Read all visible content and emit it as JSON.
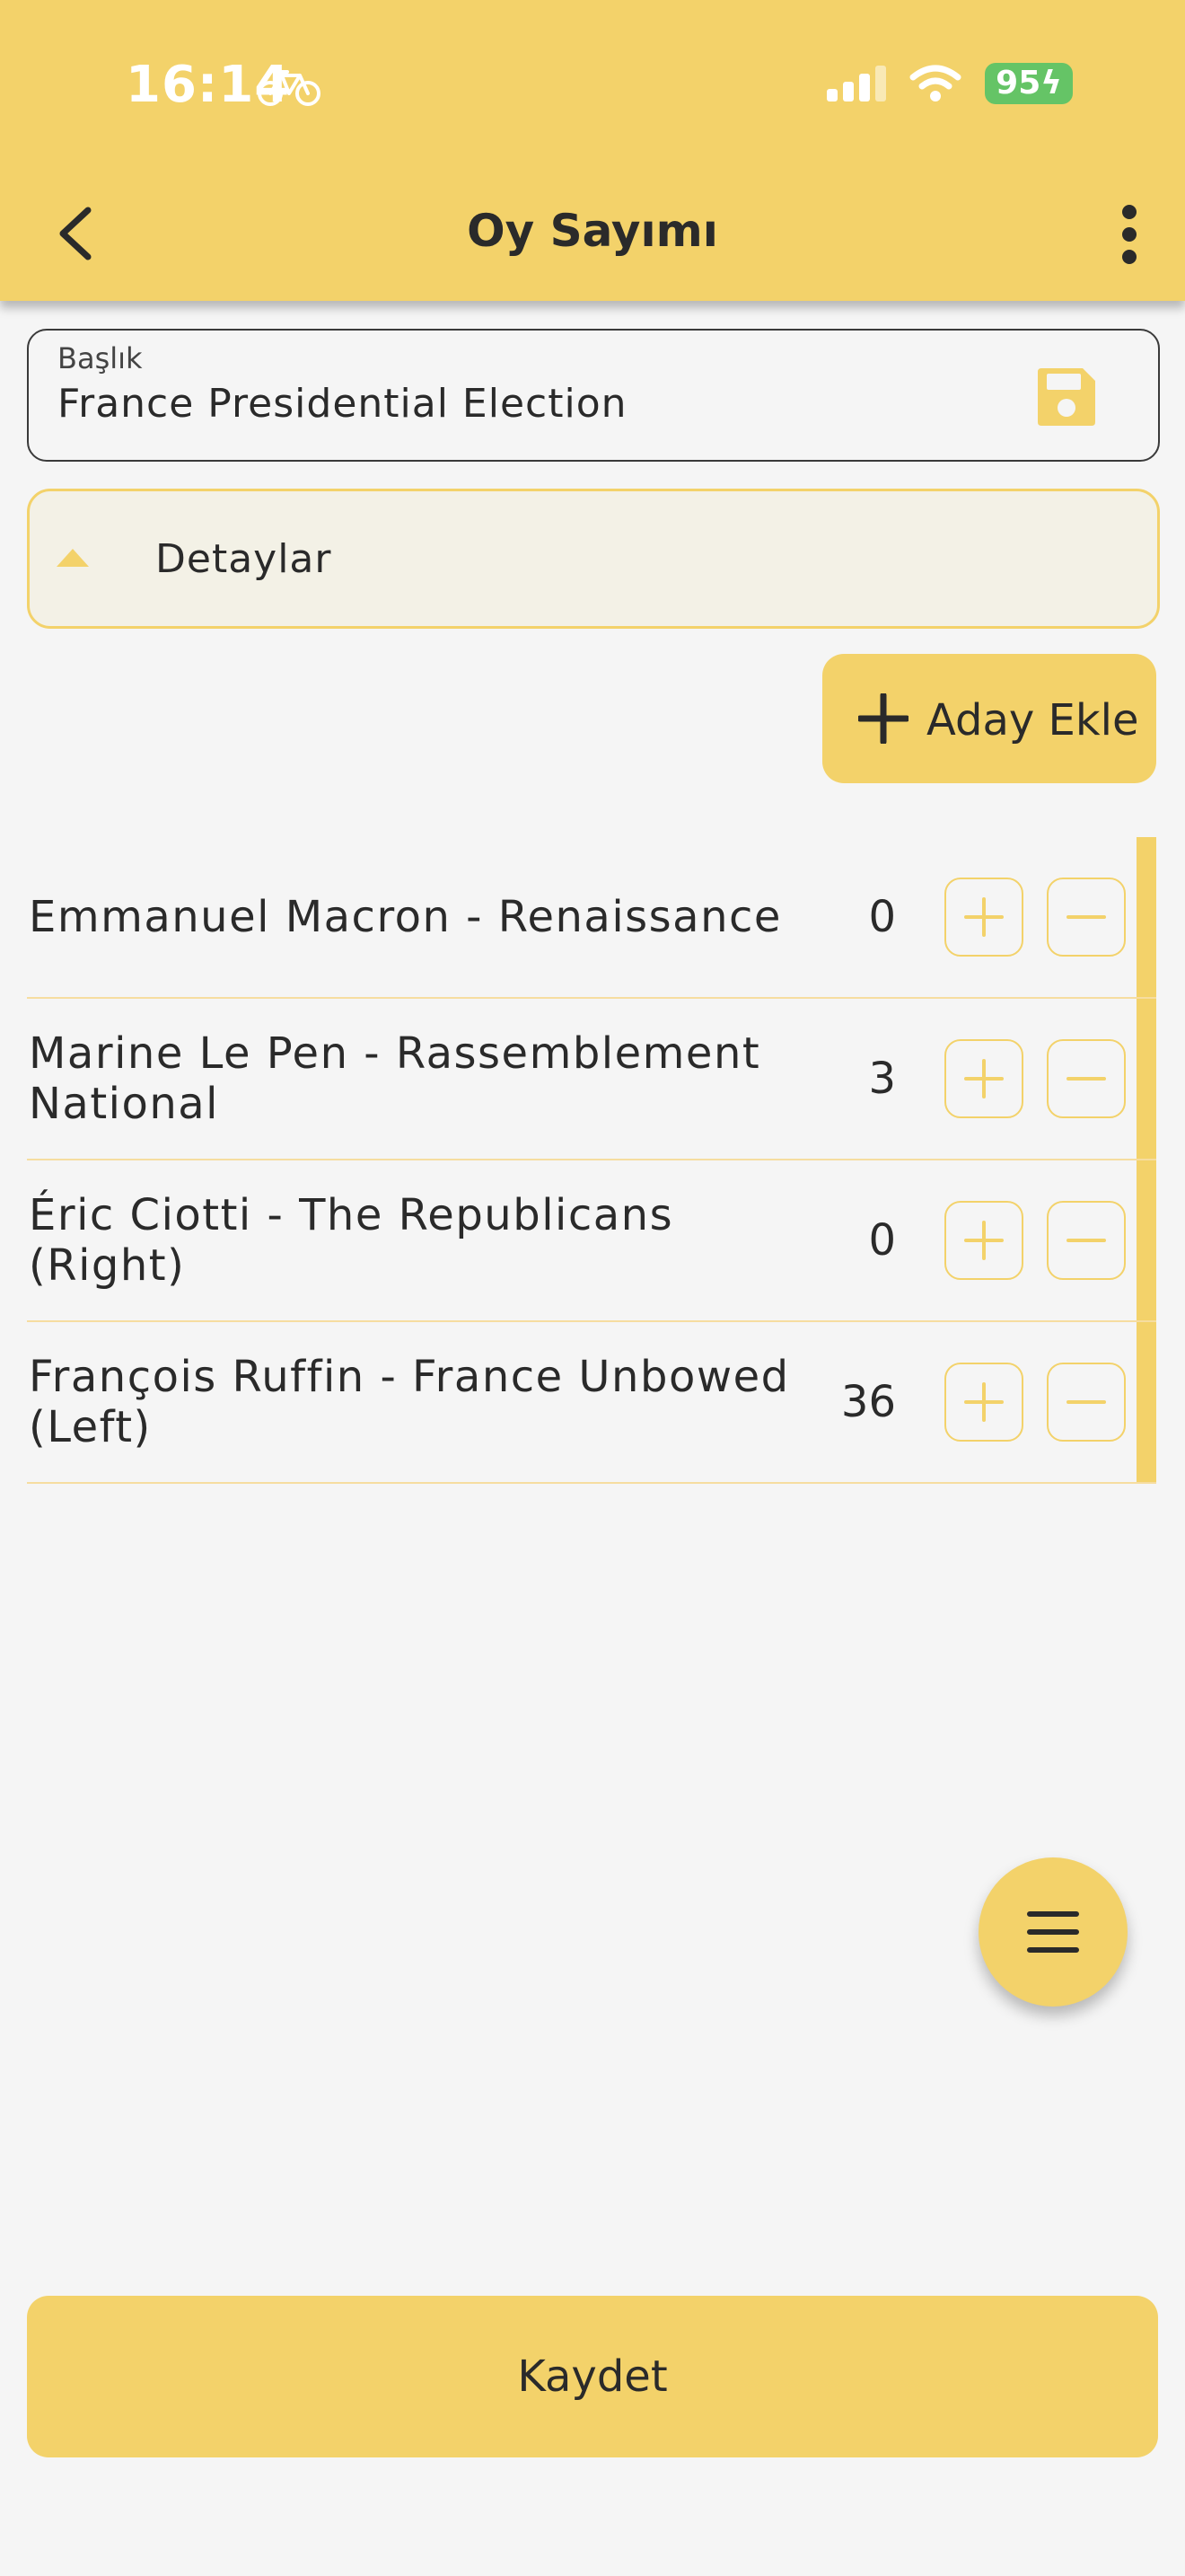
{
  "status_bar": {
    "time": "16:14",
    "battery": "95"
  },
  "header": {
    "title": "Oy Sayımı"
  },
  "title_field": {
    "label": "Başlık",
    "value": "France Presidential Election"
  },
  "details": {
    "label": "Detaylar"
  },
  "add_candidate": {
    "label": "Aday Ekle"
  },
  "candidates": [
    {
      "name": "Emmanuel Macron - Renaissance",
      "votes": "0"
    },
    {
      "name": "Marine Le Pen - Rassemblement National",
      "votes": "3"
    },
    {
      "name": "Éric Ciotti - The Republicans (Right)",
      "votes": "0"
    },
    {
      "name": "François Ruffin - France Unbowed (Left)",
      "votes": "36"
    }
  ],
  "bottom": {
    "save_label": "Kaydet"
  },
  "colors": {
    "accent": "#f3d26a",
    "background": "#f5f5f5",
    "text": "#2a2a2a",
    "battery": "#65c466"
  }
}
